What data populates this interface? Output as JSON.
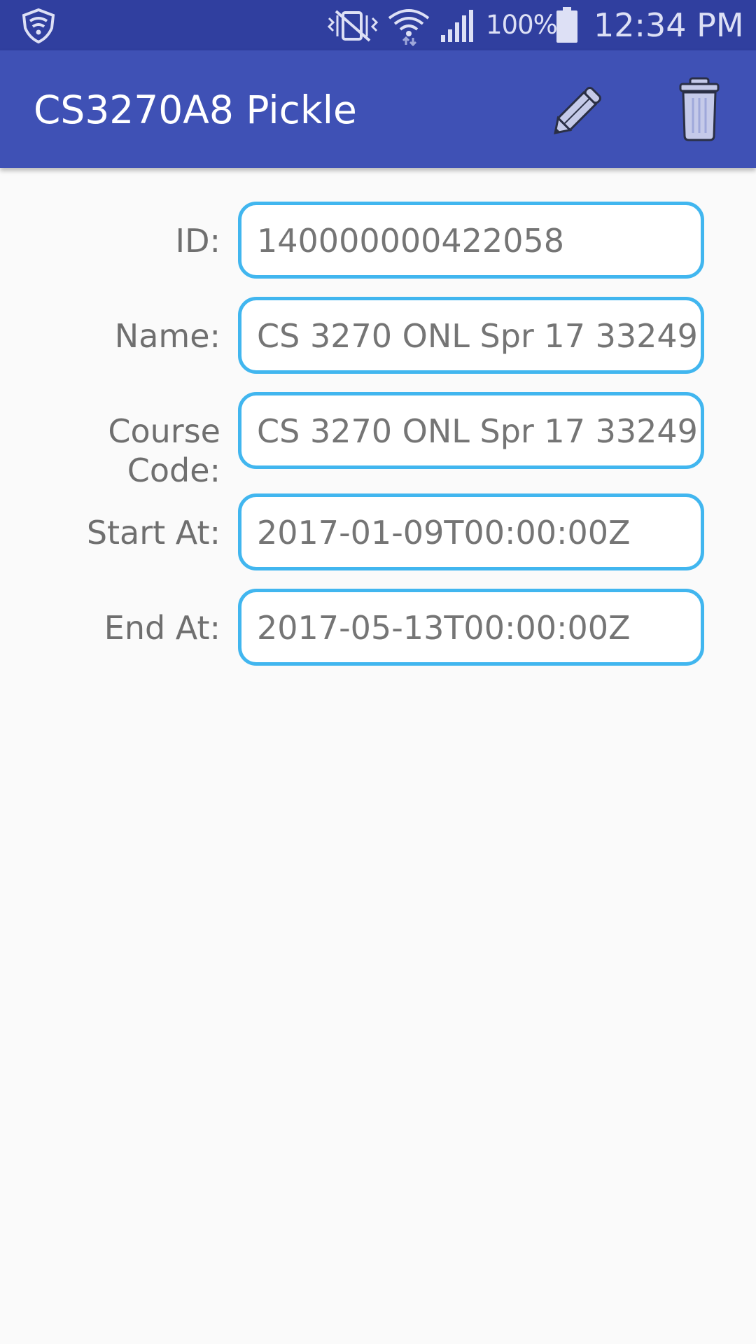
{
  "status_bar": {
    "battery_percent": "100%",
    "time": "12:34 PM",
    "icons": [
      "shield-icon",
      "vibrate-mute-icon",
      "wifi-icon",
      "signal-icon",
      "battery-icon"
    ]
  },
  "app_bar": {
    "title": "CS3270A8 Pickle",
    "actions": [
      "edit-icon",
      "delete-icon"
    ]
  },
  "form": {
    "id": {
      "label": "ID:",
      "value": "140000000422058"
    },
    "name": {
      "label": "Name:",
      "value": "CS 3270 ONL Spr 17 33249"
    },
    "course_code": {
      "label_line1": "Course",
      "label_line2": "Code:",
      "value": "CS 3270 ONL Spr 17 33249"
    },
    "start_at": {
      "label": "Start At:",
      "value": "2017-01-09T00:00:00Z"
    },
    "end_at": {
      "label": "End At:",
      "value": "2017-05-13T00:00:00Z"
    }
  },
  "colors": {
    "status_bar": "#303f9f",
    "app_bar": "#3f51b5",
    "field_border": "#41b6ef",
    "background": "#fafafa"
  }
}
